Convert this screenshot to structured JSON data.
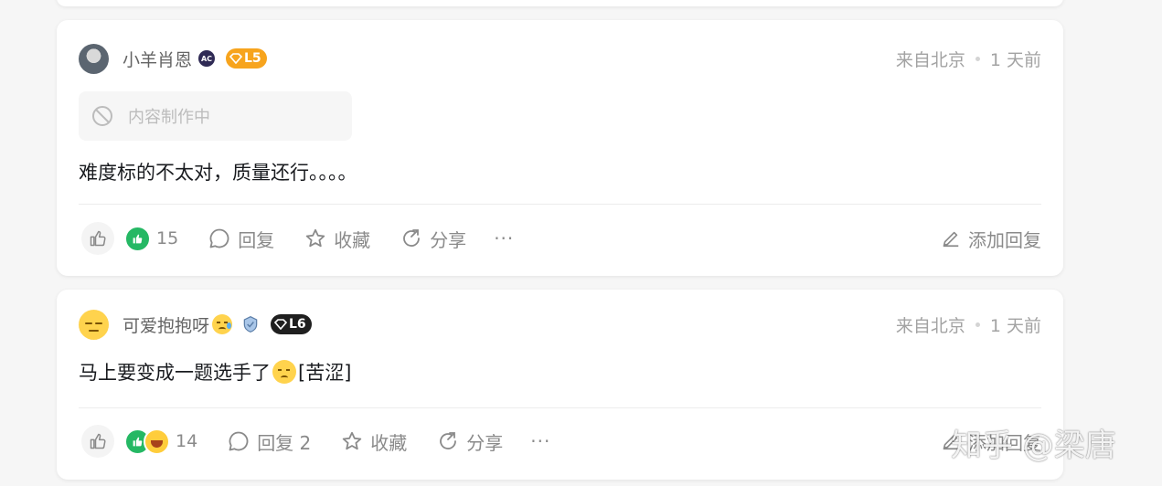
{
  "comments": [
    {
      "username": "小羊肖恩",
      "badge": "AC",
      "level": "L5",
      "location": "来自北京",
      "time": "1 天前",
      "status": "内容制作中",
      "content": "难度标的不太对，质量还行。。。。",
      "likes": "15",
      "reply_label": "回复",
      "collect_label": "收藏",
      "share_label": "分享",
      "more_label": "···",
      "add_reply_label": "添加回复"
    },
    {
      "username": "可爱抱抱呀",
      "level": "L6",
      "location": "来自北京",
      "time": "1 天前",
      "content_prefix": "马上要变成一题选手了",
      "content_suffix": "[苦涩]",
      "likes": "14",
      "reply_label": "回复 2",
      "collect_label": "收藏",
      "share_label": "分享",
      "more_label": "···",
      "add_reply_label": "添加回复"
    }
  ],
  "watermark": "知乎 @梁唐",
  "colors": {
    "green": "#25b864",
    "level5": "#f7a41d",
    "level6": "#1f1f1f",
    "muted": "#8a8a8a"
  },
  "icons": [
    "like-icon",
    "comment-icon",
    "star-icon",
    "share-icon",
    "pen-icon",
    "ban-icon",
    "shield-icon"
  ]
}
